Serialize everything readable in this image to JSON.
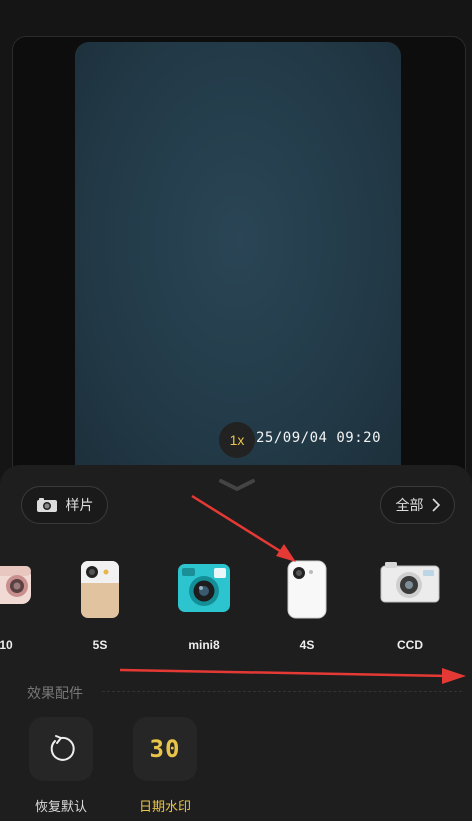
{
  "preview": {
    "zoom_label": "1x",
    "date_stamp": "25/09/04 09:20"
  },
  "sheet": {
    "collapse_icon": "chevron-down-icon",
    "sample_button": {
      "icon": "camera-icon",
      "label": "样片"
    },
    "all_button": {
      "label": "全部",
      "icon": "chevron-right-icon"
    }
  },
  "cameras": [
    {
      "label": "10",
      "icon": "pink-instant-camera-icon"
    },
    {
      "label": "5S",
      "icon": "gold-phone-camera-icon"
    },
    {
      "label": "mini8",
      "icon": "teal-instax-camera-icon"
    },
    {
      "label": "4S",
      "icon": "white-phone-camera-icon"
    },
    {
      "label": "CCD",
      "icon": "silver-ccd-camera-icon"
    }
  ],
  "effects": {
    "section_title": "效果配件",
    "tools": [
      {
        "label": "恢复默认",
        "icon": "reset-icon"
      },
      {
        "label": "日期水印",
        "icon": "digital-date-icon",
        "digits": "30"
      }
    ]
  },
  "colors": {
    "accent_yellow": "#e8c54a",
    "annotation_red": "#e53935"
  }
}
